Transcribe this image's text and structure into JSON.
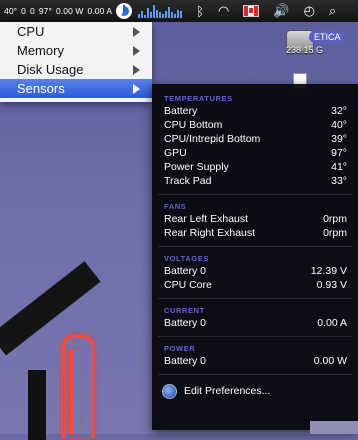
{
  "menubar": {
    "stats": [
      "40°",
      "0",
      "0",
      "97°",
      "0.00 W",
      "0.00 A"
    ],
    "activity_bars": [
      3,
      5,
      2,
      7,
      4,
      9,
      6,
      4,
      3,
      5,
      8,
      4,
      3,
      6,
      5
    ]
  },
  "desktop": {
    "drive_label": "ETICA",
    "drive_size": "238.15 G"
  },
  "menu": {
    "items": [
      {
        "label": "CPU",
        "selected": false
      },
      {
        "label": "Memory",
        "selected": false
      },
      {
        "label": "Disk Usage",
        "selected": false
      },
      {
        "label": "Sensors",
        "selected": true
      }
    ]
  },
  "sensors": {
    "temperatures": {
      "title": "TEMPERATURES",
      "rows": [
        {
          "name": "Battery",
          "value": "32°"
        },
        {
          "name": "CPU Bottom",
          "value": "40°"
        },
        {
          "name": "CPU/Intrepid Bottom",
          "value": "39°"
        },
        {
          "name": "GPU",
          "value": "97°"
        },
        {
          "name": "Power Supply",
          "value": "41°"
        },
        {
          "name": "Track Pad",
          "value": "33°"
        }
      ]
    },
    "fans": {
      "title": "FANS",
      "rows": [
        {
          "name": "Rear Left Exhaust",
          "value": "0rpm"
        },
        {
          "name": "Rear Right Exhaust",
          "value": "0rpm"
        }
      ]
    },
    "voltages": {
      "title": "VOLTAGES",
      "rows": [
        {
          "name": "Battery 0",
          "value": "12.39 V"
        },
        {
          "name": "CPU Core",
          "value": "0.93 V"
        }
      ]
    },
    "current": {
      "title": "CURRENT",
      "rows": [
        {
          "name": "Battery 0",
          "value": "0.00 A"
        }
      ]
    },
    "power": {
      "title": "POWER",
      "rows": [
        {
          "name": "Battery 0",
          "value": "0.00 W"
        }
      ]
    },
    "edit_label": "Edit Preferences..."
  },
  "colors": {
    "selection": "#2c59d7",
    "section_title": "#6a5fd0"
  }
}
